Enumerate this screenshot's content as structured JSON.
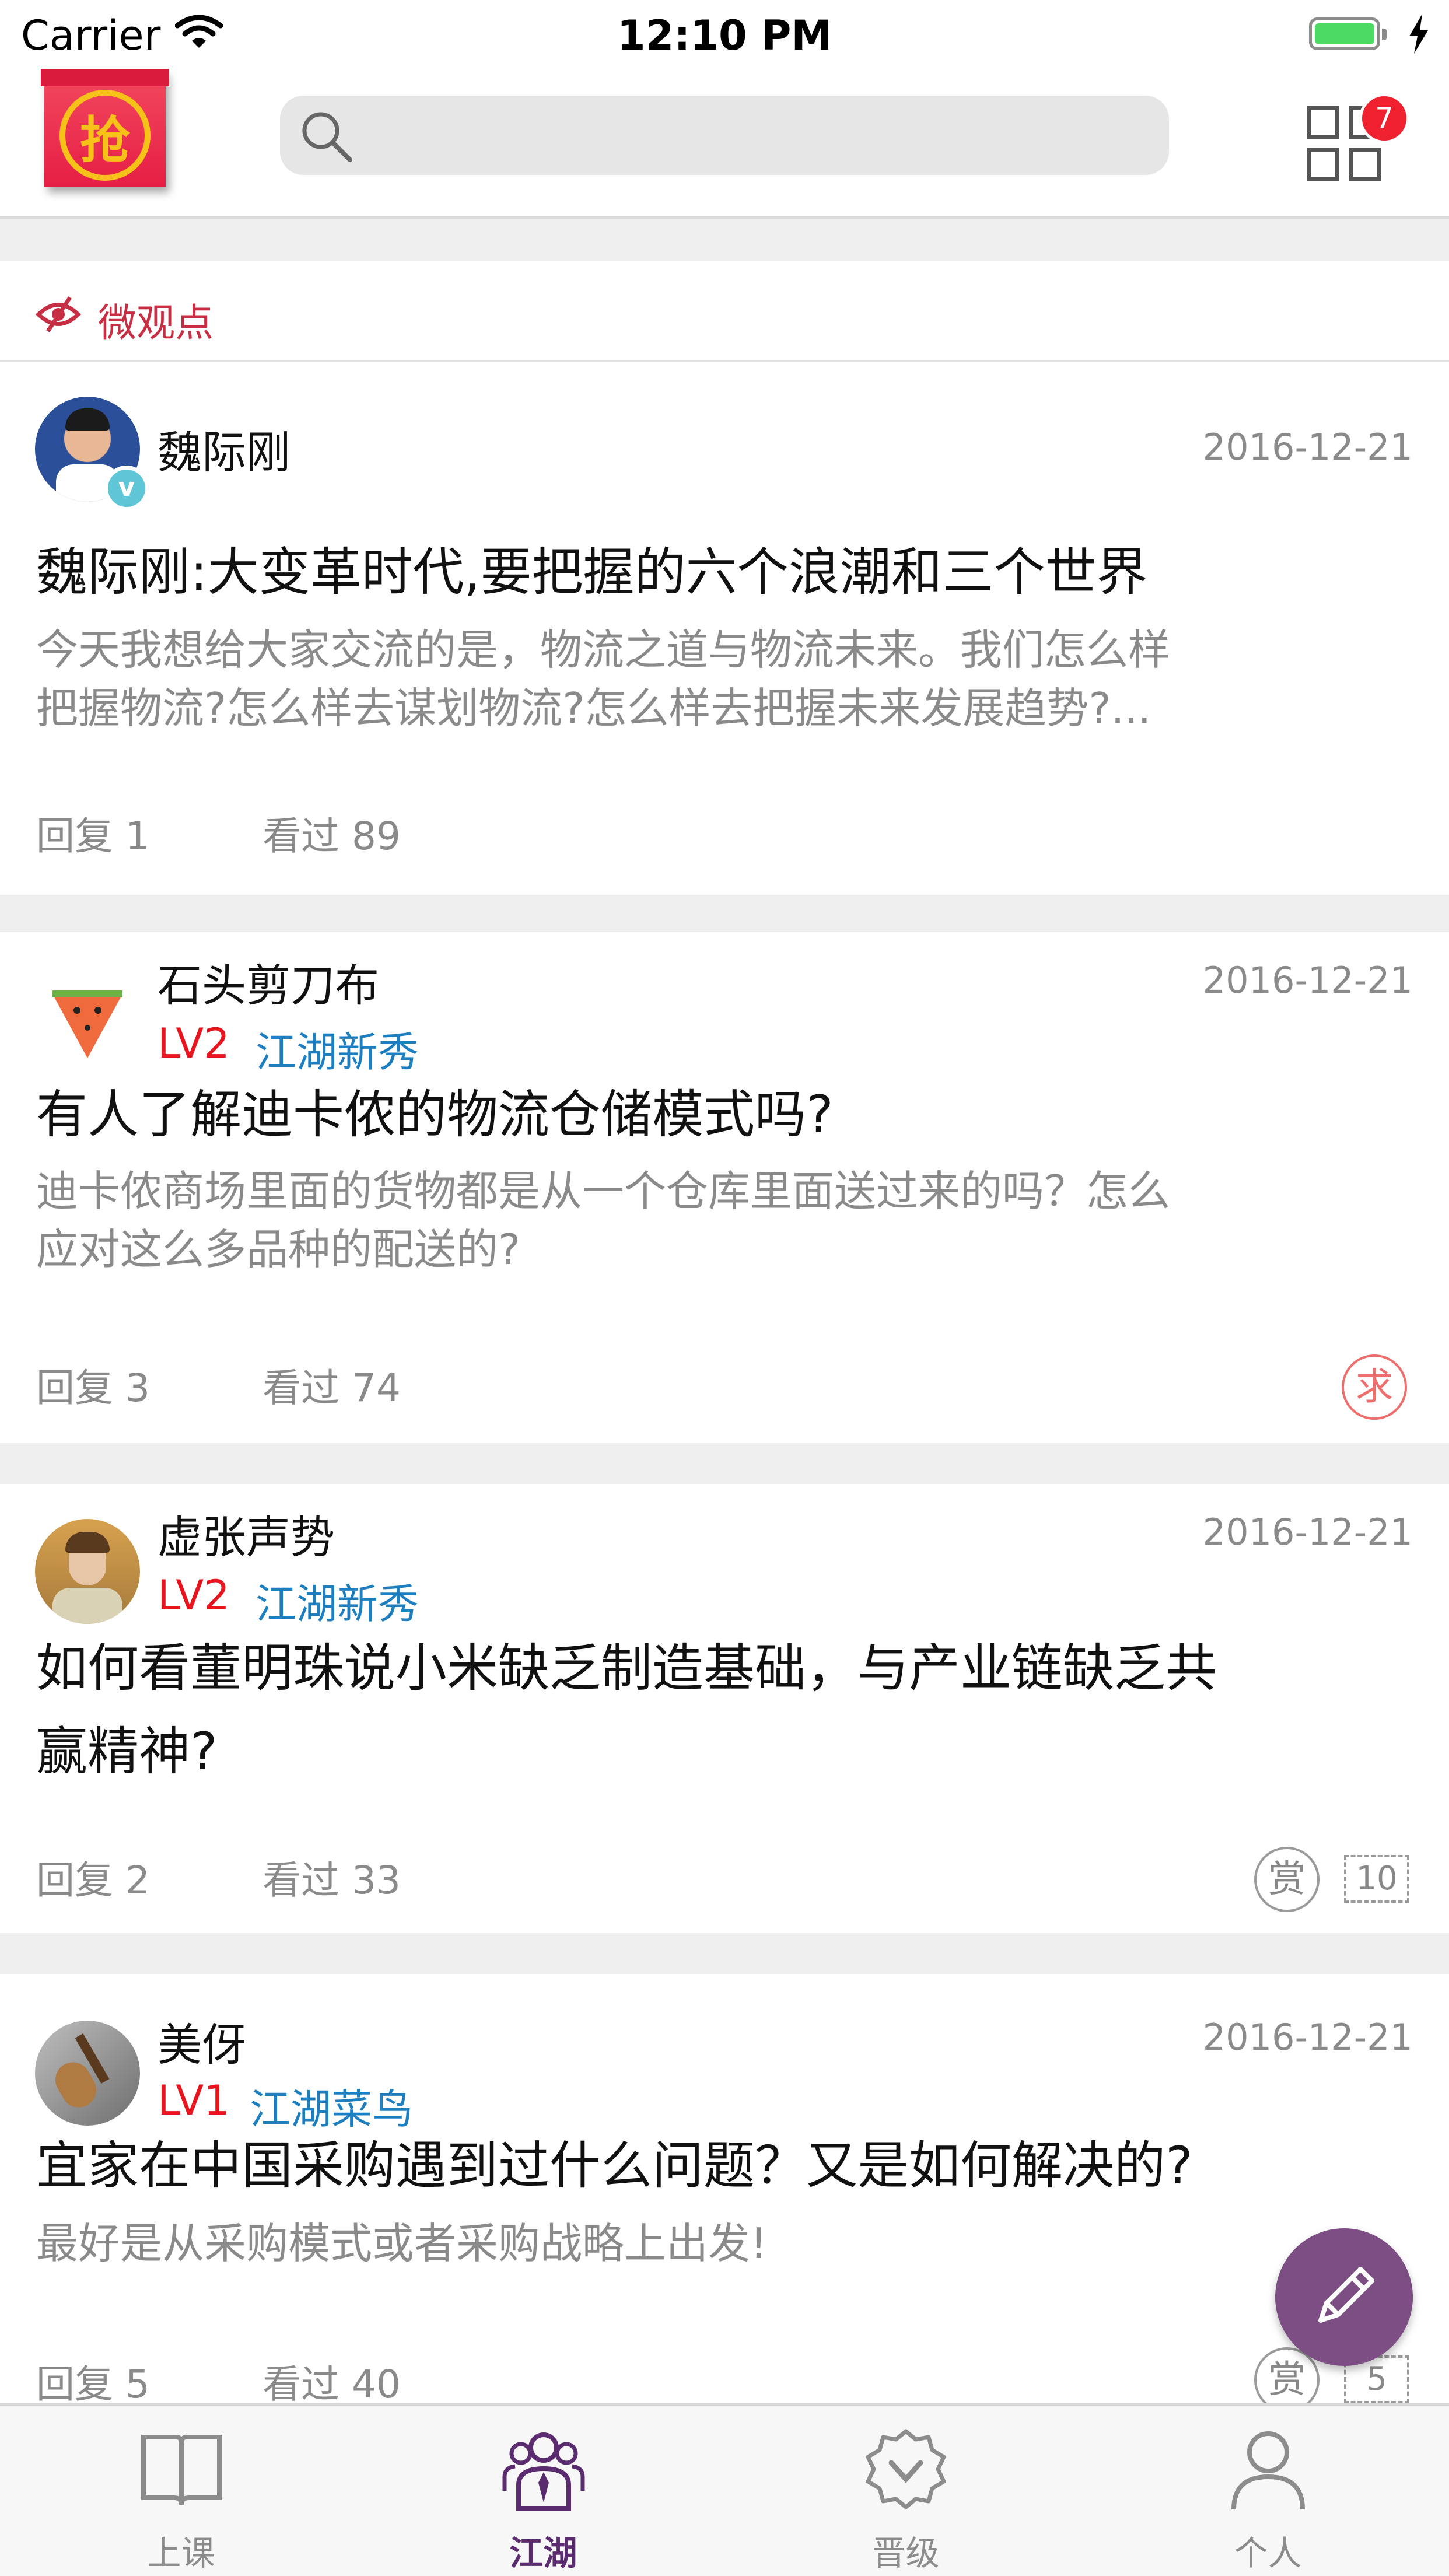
{
  "status_bar": {
    "carrier": "Carrier",
    "time": "12:10 PM"
  },
  "top_nav": {
    "logo_char": "抢",
    "badge_count": "7"
  },
  "section": {
    "title": "微观点"
  },
  "posts": [
    {
      "author": "魏际刚",
      "date": "2016-12-21",
      "title": "魏际刚:大变革时代,要把握的六个浪潮和三个世界",
      "desc_lines": [
        "今天我想给大家交流的是，物流之道与物流未来。我们怎么样",
        "把握物流?怎么样去谋划物流?怎么样去把握未来发展趋势?..."
      ],
      "reply": "回复 1",
      "views": "看过 89"
    },
    {
      "author": "石头剪刀布",
      "level": "LV2",
      "rank": "江湖新秀",
      "date": "2016-12-21",
      "title": "有人了解迪卡侬的物流仓储模式吗?",
      "desc_lines": [
        "迪卡侬商场里面的货物都是从一个仓库里面送过来的吗？怎么",
        "应对这么多品种的配送的?"
      ],
      "reply": "回复 3",
      "views": "看过 74",
      "seal": "求"
    },
    {
      "author": "虚张声势",
      "level": "LV2",
      "rank": "江湖新秀",
      "date": "2016-12-21",
      "title_lines": [
        "如何看董明珠说小米缺乏制造基础，与产业链缺乏共",
        "赢精神?"
      ],
      "reply": "回复 2",
      "views": "看过 33",
      "seal": "赏",
      "coins": "10"
    },
    {
      "author": "美伢",
      "level": "LV1",
      "rank": "江湖菜鸟",
      "date": "2016-12-21",
      "title": "宜家在中国采购遇到过什么问题？又是如何解决的?",
      "desc": "最好是从采购模式或者采购战略上出发!",
      "reply": "回复 5",
      "views": "看过 40",
      "seal": "赏",
      "coins": "5"
    }
  ],
  "tabs": [
    {
      "label": "上课",
      "icon": "book-icon"
    },
    {
      "label": "江湖",
      "icon": "community-icon",
      "active": true
    },
    {
      "label": "晋级",
      "icon": "badge-icon"
    },
    {
      "label": "个人",
      "icon": "person-icon"
    }
  ],
  "colors": {
    "accent": "#5a2b6e",
    "level": "#e8141e",
    "rank": "#1e7fc0",
    "section": "#c62f43"
  }
}
